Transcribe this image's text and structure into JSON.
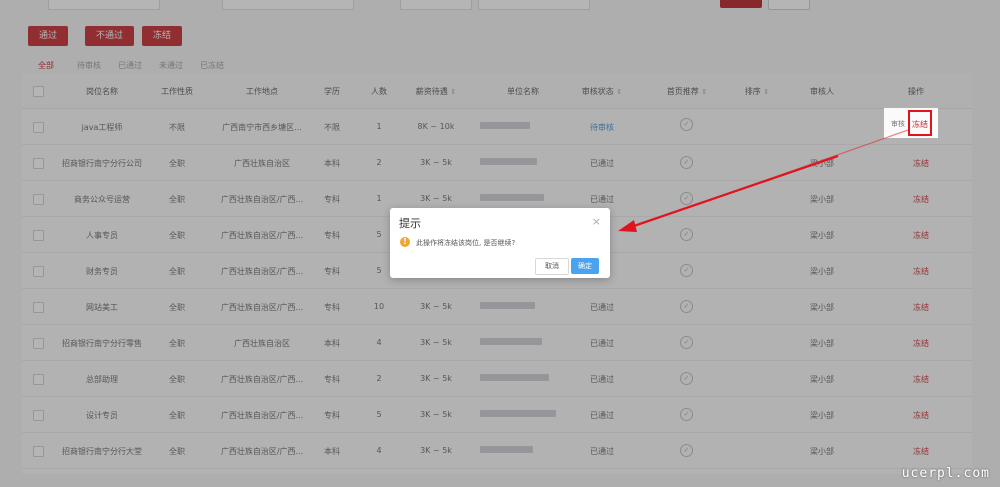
{
  "actions": {
    "pass": "通过",
    "fail": "不通过",
    "freeze": "冻结"
  },
  "tabs": [
    {
      "label": "全部",
      "active": true
    },
    {
      "label": "待审核",
      "active": false
    },
    {
      "label": "已通过",
      "active": false
    },
    {
      "label": "未通过",
      "active": false
    },
    {
      "label": "已冻结",
      "active": false
    }
  ],
  "table": {
    "headers": {
      "position": "岗位名称",
      "nature": "工作性质",
      "location": "工作地点",
      "education": "学历",
      "headcount": "人数",
      "salary": "薪资待遇",
      "company": "单位名称",
      "status": "审核状态",
      "homepage": "首页推荐",
      "sort": "排序",
      "reviewer": "审核人",
      "operation": "操作"
    },
    "rows": [
      {
        "position": "java工程师",
        "nature": "不限",
        "location": "广西南宁市西乡塘区...",
        "education": "不限",
        "headcount": "1",
        "salary": "8K ~ 10k",
        "status": "待审核",
        "reviewer": "",
        "op1": "审核",
        "op2": "冻结"
      },
      {
        "position": "招商银行南宁分行公司...",
        "nature": "全职",
        "location": "广西壮族自治区",
        "education": "本科",
        "headcount": "2",
        "salary": "3K ~ 5k",
        "status": "已通过",
        "reviewer": "梁小部",
        "op1": "",
        "op2": "冻结"
      },
      {
        "position": "商务公众号运营",
        "nature": "全职",
        "location": "广西壮族自治区/广西...",
        "education": "专科",
        "headcount": "1",
        "salary": "3K ~ 5k",
        "status": "已通过",
        "reviewer": "梁小部",
        "op1": "",
        "op2": "冻结"
      },
      {
        "position": "人事专员",
        "nature": "全职",
        "location": "广西壮族自治区/广西...",
        "education": "专科",
        "headcount": "5",
        "salary": "",
        "status": "",
        "reviewer": "梁小部",
        "op1": "",
        "op2": "冻结"
      },
      {
        "position": "财务专员",
        "nature": "全职",
        "location": "广西壮族自治区/广西...",
        "education": "专科",
        "headcount": "5",
        "salary": "",
        "status": "",
        "reviewer": "梁小部",
        "op1": "",
        "op2": "冻结"
      },
      {
        "position": "网站美工",
        "nature": "全职",
        "location": "广西壮族自治区/广西...",
        "education": "专科",
        "headcount": "10",
        "salary": "3K ~ 5k",
        "status": "已通过",
        "reviewer": "梁小部",
        "op1": "",
        "op2": "冻结"
      },
      {
        "position": "招商银行南宁分行零售...",
        "nature": "全职",
        "location": "广西壮族自治区",
        "education": "本科",
        "headcount": "4",
        "salary": "3K ~ 5k",
        "status": "已通过",
        "reviewer": "梁小部",
        "op1": "",
        "op2": "冻结"
      },
      {
        "position": "总部助理",
        "nature": "全职",
        "location": "广西壮族自治区/广西...",
        "education": "专科",
        "headcount": "2",
        "salary": "3K ~ 5k",
        "status": "已通过",
        "reviewer": "梁小部",
        "op1": "",
        "op2": "冻结"
      },
      {
        "position": "设计专员",
        "nature": "全职",
        "location": "广西壮族自治区/广西...",
        "education": "专科",
        "headcount": "5",
        "salary": "3K ~ 5k",
        "status": "已通过",
        "reviewer": "梁小部",
        "op1": "",
        "op2": "冻结"
      },
      {
        "position": "招商银行南宁分行大堂...",
        "nature": "全职",
        "location": "广西壮族自治区/广西...",
        "education": "本科",
        "headcount": "4",
        "salary": "3K ~ 5k",
        "status": "已通过",
        "reviewer": "梁小部",
        "op1": "",
        "op2": "冻结"
      }
    ]
  },
  "dialog": {
    "title": "提示",
    "close": "×",
    "icon": "!",
    "message": "此操作将冻结该岗位, 是否继续?",
    "cancel": "取消",
    "confirm": "确定"
  },
  "highlight": {
    "label": "冻结",
    "review": "审核"
  },
  "watermark": "ucerpl.com",
  "colors": {
    "brand_red": "#c4262c",
    "confirm_blue": "#4aa3ee",
    "warning": "#f0a532",
    "annotation": "#e0141c"
  }
}
